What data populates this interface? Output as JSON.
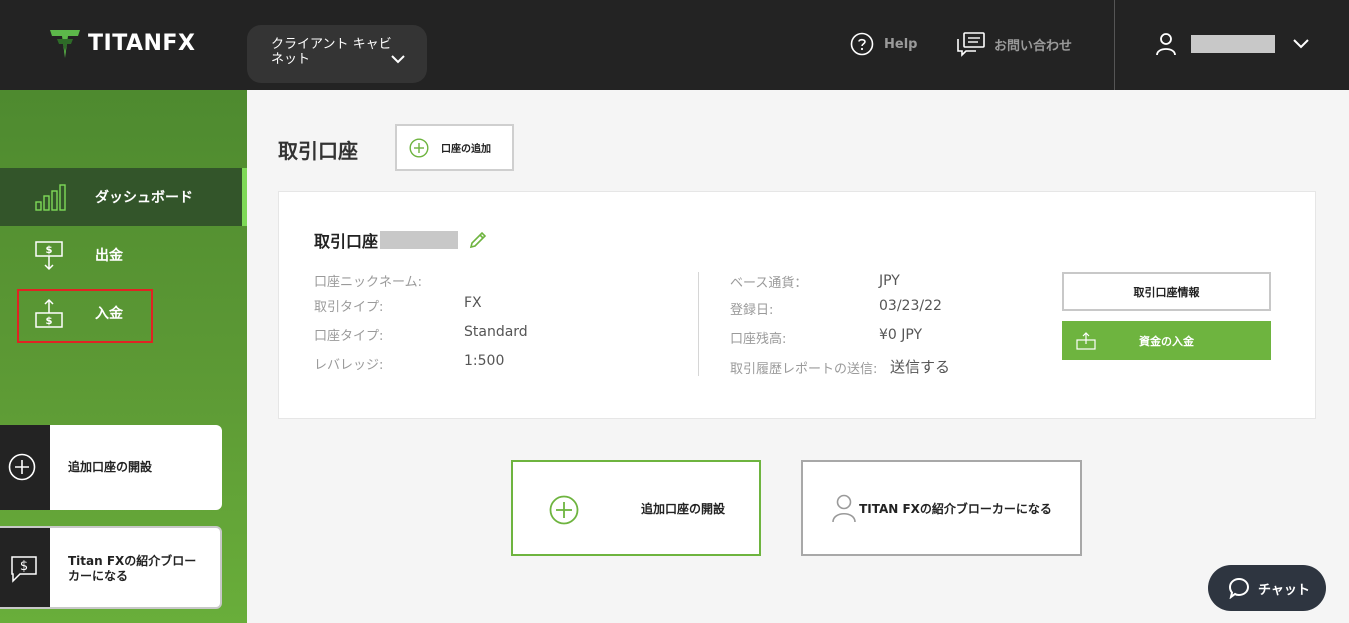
{
  "header": {
    "logo_text": "TITANFX",
    "cabinet_label": "クライアント キャビネット",
    "help_label": "Help",
    "contact_label": "お問い合わせ"
  },
  "sidebar": {
    "items": [
      {
        "label": "ダッシュボード",
        "icon": "bar-chart-icon",
        "active": true
      },
      {
        "label": "出金",
        "icon": "withdraw-icon",
        "active": false
      },
      {
        "label": "入金",
        "icon": "deposit-icon",
        "active": false
      }
    ],
    "cards": [
      {
        "label": "追加口座の開設",
        "icon": "plus-circle-icon"
      },
      {
        "label": "Titan FXの紹介ブローカーになる",
        "icon": "dollar-chat-icon"
      }
    ]
  },
  "main": {
    "title": "取引口座",
    "add_account_label": "口座の追加",
    "account": {
      "title": "取引口座",
      "left_fields": [
        {
          "key": "口座ニックネーム:",
          "value": ""
        },
        {
          "key": "取引タイプ:",
          "value": "FX"
        },
        {
          "key": "口座タイプ:",
          "value": "Standard"
        },
        {
          "key": "レバレッジ:",
          "value": "1:500"
        }
      ],
      "right_fields": [
        {
          "key": "ベース通貨：",
          "value": "JPY"
        },
        {
          "key": "登録日:",
          "value": "03/23/22"
        },
        {
          "key": "口座残高:",
          "value": "¥0 JPY"
        },
        {
          "key": "取引履歴レポートの送信:",
          "value": "送信する"
        }
      ],
      "info_button": "取引口座情報",
      "deposit_button": "資金の入金"
    },
    "open_account_label": "追加口座の開設",
    "broker_label": "TITAN FXの紹介ブローカーになる"
  },
  "chat_label": "チャット",
  "colors": {
    "accent_green": "#6eb43f",
    "topbar": "#232323",
    "sidebar_active": "#33552a",
    "highlight_red": "#e02323"
  }
}
